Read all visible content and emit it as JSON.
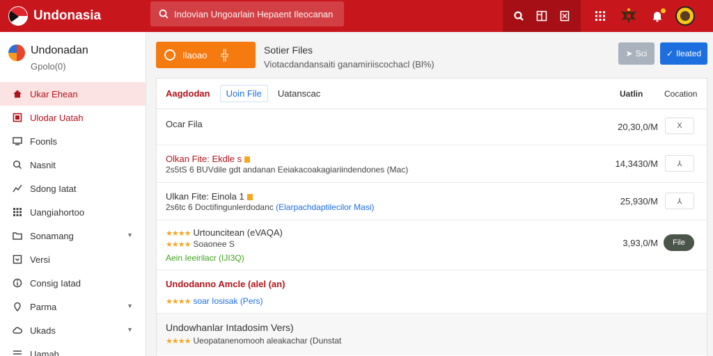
{
  "app": {
    "brand": "Undonasia"
  },
  "search": {
    "placeholder": "Indovian Ungoarlain Hepaent Ileocanan"
  },
  "sidebar": {
    "title": "Undonadan",
    "subtitle": "Gpolo(0)",
    "items": [
      {
        "label": "Ukar Ehean",
        "icon": "home-icon"
      },
      {
        "label": "Ulodar Uatah",
        "icon": "upload-icon"
      },
      {
        "label": "Foonls",
        "icon": "monitor-icon"
      },
      {
        "label": "Nasnit",
        "icon": "search-icon"
      },
      {
        "label": "Sdong Iatat",
        "icon": "chart-icon"
      },
      {
        "label": "Uangiahortoo",
        "icon": "grid-icon"
      },
      {
        "label": "Sonamang",
        "icon": "folder-icon"
      },
      {
        "label": "Versi",
        "icon": "download-icon"
      },
      {
        "label": "Consig Iatad",
        "icon": "info-icon"
      },
      {
        "label": "Parma",
        "icon": "pin-icon"
      },
      {
        "label": "Ukads",
        "icon": "cloud-icon"
      },
      {
        "label": "Uamah",
        "icon": "list-icon"
      }
    ]
  },
  "header": {
    "upload_label": "Ilaoao",
    "upload_plus": "╬",
    "title": "Sotier Files",
    "subtitle": "Viotacdandansaiti ganamiriiscochacl (Bl%)",
    "btn_secondary": "Sci",
    "btn_primary": "Ileated"
  },
  "tabs": [
    {
      "label": "Aagdodan"
    },
    {
      "label": "Uoin File"
    },
    {
      "label": "Uatanscac"
    }
  ],
  "columns": {
    "size": "Uatlin",
    "action": "Cocation"
  },
  "rows": [
    {
      "title": "Ocar Fila",
      "size": "20,30,0/M",
      "action": "X"
    },
    {
      "title": "Olkan Fite: Ekdle s",
      "sub": "2s5tS 6 BUVdile gdt andanan Eeiakacoakagiariindendones (Mac)",
      "size": "14,3430/M",
      "action": "⅄"
    },
    {
      "title": "Ulkan Fite: Einola 1",
      "sub_a": "2s6tc 6 Doctifingunlerdodanc",
      "sub_b": "(Elarpachdaptilecilor Masi)",
      "size": "25,930/M",
      "action": "⅄"
    },
    {
      "title": "Urtouncitean (eVAQA)",
      "line2": "Soaonee S",
      "line3_a": "Aein Ieeirilacr",
      "line3_b": "(IJI3Q)",
      "size": "3,93,0/M",
      "action": "File"
    },
    {
      "title": "Undodanno Amcle (alel (an)",
      "sub": "soar Iosisak (Pers)"
    },
    {
      "title": "Undowhanlar Intadosim Vers)",
      "sub": "Ueopatanenomooh aleakachar (Dunstat"
    }
  ],
  "colors": {
    "topbar": "#c8161d",
    "accent_orange": "#f57a0f",
    "accent_blue": "#1d6fe0"
  }
}
